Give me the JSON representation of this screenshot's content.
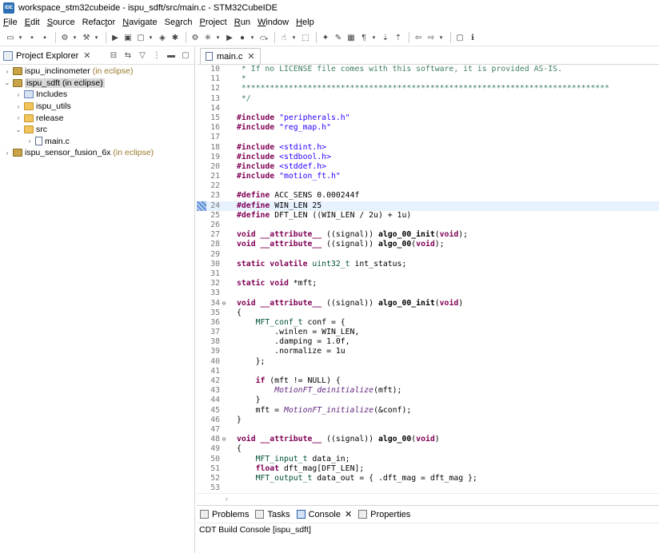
{
  "window": {
    "app_icon_text": "IDE",
    "title": "workspace_stm32cubeide - ispu_sdft/src/main.c - STM32CubeIDE"
  },
  "menu": [
    {
      "pre": "",
      "u": "F",
      "post": "ile"
    },
    {
      "pre": "",
      "u": "E",
      "post": "dit"
    },
    {
      "pre": "",
      "u": "S",
      "post": "ource"
    },
    {
      "pre": "Refac",
      "u": "t",
      "post": "or"
    },
    {
      "pre": "",
      "u": "N",
      "post": "avigate"
    },
    {
      "pre": "Se",
      "u": "a",
      "post": "rch"
    },
    {
      "pre": "",
      "u": "P",
      "post": "roject"
    },
    {
      "pre": "",
      "u": "R",
      "post": "un"
    },
    {
      "pre": "",
      "u": "W",
      "post": "indow"
    },
    {
      "pre": "",
      "u": "H",
      "post": "elp"
    }
  ],
  "explorer": {
    "tab_label": "Project Explorer",
    "close_glyph": "✕",
    "items": [
      {
        "arrow": "›",
        "icon": "project",
        "label": "ispu_inclinometer",
        "sub": "(in eclipse)",
        "indent": 0
      },
      {
        "arrow": "⌄",
        "icon": "project",
        "label": "ispu_sdft (in eclipse)",
        "sub": "",
        "indent": 0,
        "selected": true
      },
      {
        "arrow": "›",
        "icon": "includes",
        "label": "Includes",
        "sub": "",
        "indent": 1
      },
      {
        "arrow": "›",
        "icon": "folder",
        "label": "ispu_utils",
        "sub": "",
        "indent": 1
      },
      {
        "arrow": "›",
        "icon": "folder",
        "label": "release",
        "sub": "",
        "indent": 1
      },
      {
        "arrow": "⌄",
        "icon": "folder",
        "label": "src",
        "sub": "",
        "indent": 1
      },
      {
        "arrow": "›",
        "icon": "file",
        "label": "main.c",
        "sub": "",
        "indent": 2
      },
      {
        "arrow": "›",
        "icon": "project",
        "label": "ispu_sensor_fusion_6x",
        "sub": "(in eclipse)",
        "indent": 0
      }
    ]
  },
  "editor": {
    "tab_label": "main.c",
    "close_glyph": "✕",
    "scroll_glyph": "‹",
    "lines": [
      {
        "n": "10",
        "text": " * If no LICENSE file comes with this software, it is provided AS-IS.",
        "cls": "c"
      },
      {
        "n": "11",
        "text": " *",
        "cls": "c"
      },
      {
        "n": "12",
        "text": " ******************************************************************************",
        "cls": "c"
      },
      {
        "n": "13",
        "text": " */",
        "cls": "c"
      },
      {
        "n": "14",
        "text": ""
      },
      {
        "n": "15",
        "parts": [
          [
            "#include",
            "k"
          ],
          [
            " ",
            ""
          ],
          [
            "\"peripherals.h\"",
            "s"
          ]
        ]
      },
      {
        "n": "16",
        "parts": [
          [
            "#include",
            "k"
          ],
          [
            " ",
            ""
          ],
          [
            "\"reg_map.h\"",
            "s"
          ]
        ]
      },
      {
        "n": "17",
        "text": ""
      },
      {
        "n": "18",
        "parts": [
          [
            "#include",
            "k"
          ],
          [
            " ",
            ""
          ],
          [
            "<stdint.h>",
            "s"
          ]
        ]
      },
      {
        "n": "19",
        "parts": [
          [
            "#include",
            "k"
          ],
          [
            " ",
            ""
          ],
          [
            "<stdbool.h>",
            "s"
          ]
        ]
      },
      {
        "n": "20",
        "parts": [
          [
            "#include",
            "k"
          ],
          [
            " ",
            ""
          ],
          [
            "<stddef.h>",
            "s"
          ]
        ]
      },
      {
        "n": "21",
        "parts": [
          [
            "#include",
            "k"
          ],
          [
            " ",
            ""
          ],
          [
            "\"motion_ft.h\"",
            "s"
          ]
        ]
      },
      {
        "n": "22",
        "text": ""
      },
      {
        "n": "23",
        "parts": [
          [
            "#define",
            "k"
          ],
          [
            " ACC_SENS 0.000244f",
            ""
          ]
        ]
      },
      {
        "n": "24",
        "parts": [
          [
            "#define",
            "k"
          ],
          [
            " WIN_LEN 25",
            ""
          ]
        ],
        "bookmark": true,
        "current": true
      },
      {
        "n": "25",
        "parts": [
          [
            "#define",
            "k"
          ],
          [
            " DFT_LEN ((WIN_LEN / 2u) + 1u)",
            ""
          ]
        ]
      },
      {
        "n": "26",
        "text": ""
      },
      {
        "n": "27",
        "parts": [
          [
            "void",
            "k"
          ],
          [
            " ",
            ""
          ],
          [
            "__attribute__",
            "k"
          ],
          [
            " ((signal)) ",
            ""
          ],
          [
            "algo_00_init",
            "f"
          ],
          [
            "(",
            ""
          ],
          [
            "void",
            "k"
          ],
          [
            ");",
            ""
          ]
        ]
      },
      {
        "n": "28",
        "parts": [
          [
            "void",
            "k"
          ],
          [
            " ",
            ""
          ],
          [
            "__attribute__",
            "k"
          ],
          [
            " ((signal)) ",
            ""
          ],
          [
            "algo_00",
            "f"
          ],
          [
            "(",
            ""
          ],
          [
            "void",
            "k"
          ],
          [
            ");",
            ""
          ]
        ]
      },
      {
        "n": "29",
        "text": ""
      },
      {
        "n": "30",
        "parts": [
          [
            "static",
            "k"
          ],
          [
            " ",
            ""
          ],
          [
            "volatile",
            "k"
          ],
          [
            " ",
            ""
          ],
          [
            "uint32_t",
            "t"
          ],
          [
            " int_status;",
            ""
          ]
        ]
      },
      {
        "n": "31",
        "text": ""
      },
      {
        "n": "32",
        "parts": [
          [
            "static",
            "k"
          ],
          [
            " ",
            ""
          ],
          [
            "void",
            "k"
          ],
          [
            " *mft;",
            ""
          ]
        ]
      },
      {
        "n": "33",
        "text": ""
      },
      {
        "n": "34",
        "fold": "⊖",
        "parts": [
          [
            "void",
            "k"
          ],
          [
            " ",
            ""
          ],
          [
            "__attribute__",
            "k"
          ],
          [
            " ((signal)) ",
            ""
          ],
          [
            "algo_00_init",
            "f"
          ],
          [
            "(",
            ""
          ],
          [
            "void",
            "k"
          ],
          [
            ")",
            ""
          ]
        ]
      },
      {
        "n": "35",
        "text": "{"
      },
      {
        "n": "36",
        "parts": [
          [
            "    ",
            ""
          ],
          [
            "MFT_conf_t",
            "t"
          ],
          [
            " conf = {",
            ""
          ]
        ]
      },
      {
        "n": "37",
        "text": "        .winlen = WIN_LEN,"
      },
      {
        "n": "38",
        "text": "        .damping = 1.0f,"
      },
      {
        "n": "39",
        "text": "        .normalize = 1u"
      },
      {
        "n": "40",
        "text": "    };"
      },
      {
        "n": "41",
        "text": ""
      },
      {
        "n": "42",
        "parts": [
          [
            "    ",
            ""
          ],
          [
            "if",
            "k"
          ],
          [
            " (mft != NULL) {",
            ""
          ]
        ]
      },
      {
        "n": "43",
        "parts": [
          [
            "        ",
            ""
          ],
          [
            "MotionFT_deinitialize",
            "m"
          ],
          [
            "(mft);",
            ""
          ]
        ]
      },
      {
        "n": "44",
        "text": "    }"
      },
      {
        "n": "45",
        "parts": [
          [
            "    mft = ",
            ""
          ],
          [
            "MotionFT_initialize",
            "m"
          ],
          [
            "(&conf);",
            ""
          ]
        ]
      },
      {
        "n": "46",
        "text": "}"
      },
      {
        "n": "47",
        "text": ""
      },
      {
        "n": "48",
        "fold": "⊖",
        "parts": [
          [
            "void",
            "k"
          ],
          [
            " ",
            ""
          ],
          [
            "__attribute__",
            "k"
          ],
          [
            " ((signal)) ",
            ""
          ],
          [
            "algo_00",
            "f"
          ],
          [
            "(",
            ""
          ],
          [
            "void",
            "k"
          ],
          [
            ")",
            ""
          ]
        ]
      },
      {
        "n": "49",
        "text": "{"
      },
      {
        "n": "50",
        "parts": [
          [
            "    ",
            ""
          ],
          [
            "MFT_input_t",
            "t"
          ],
          [
            " data_in;",
            ""
          ]
        ]
      },
      {
        "n": "51",
        "parts": [
          [
            "    ",
            ""
          ],
          [
            "float",
            "k"
          ],
          [
            " dft_mag[DFT_LEN];",
            ""
          ]
        ]
      },
      {
        "n": "52",
        "parts": [
          [
            "    ",
            ""
          ],
          [
            "MFT_output_t",
            "t"
          ],
          [
            " data_out = { .dft_mag = dft_mag };",
            ""
          ]
        ]
      },
      {
        "n": "53",
        "text": ""
      }
    ]
  },
  "bottom_panel": {
    "tabs": [
      {
        "label": "Problems",
        "active": false
      },
      {
        "label": "Tasks",
        "active": false
      },
      {
        "label": "Console",
        "active": true,
        "close": "✕"
      },
      {
        "label": "Properties",
        "active": false
      }
    ],
    "console_title": "CDT Build Console [ispu_sdft]"
  },
  "toolbar": {
    "icons": [
      "new-icon",
      "save-icon",
      "save-all-icon",
      "build-settings-icon",
      "build-icon",
      "debug-config-icon",
      "new-project-icon",
      "new-folder-icon",
      "new-class-icon",
      "device-config-icon",
      "tools-icon",
      "debug-icon",
      "run-icon",
      "external-tools-icon",
      "skip-icon",
      "search-icon",
      "refactor-icon",
      "open-type-icon",
      "highlight-icon",
      "block-select-icon",
      "whitespace-icon",
      "annotation-next-icon",
      "annotation-prev-icon",
      "back-icon",
      "forward-icon",
      "new-window-icon",
      "info-icon"
    ],
    "glyphs": [
      "▭",
      "▪",
      "▪",
      "⚙",
      "⚒",
      "▶",
      "▣",
      "▢",
      "◈",
      "✱",
      "⚙",
      "✳",
      "▶",
      "●",
      "⤼",
      "☝",
      "⬚",
      "✦",
      "✎",
      "▦",
      "¶",
      "⇣",
      "⇡",
      "⇦",
      "⇨",
      "▢",
      "ℹ"
    ]
  }
}
